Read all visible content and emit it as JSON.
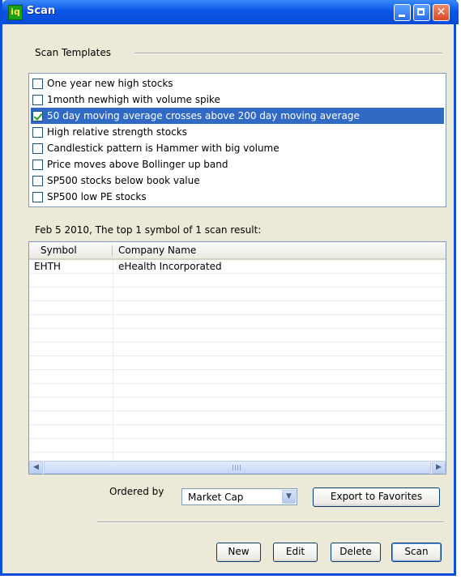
{
  "window": {
    "title": "Scan",
    "app_icon_glyph": "iq"
  },
  "templates": {
    "heading": "Scan Templates",
    "items": [
      {
        "label": "One year new high stocks",
        "checked": false,
        "selected": false
      },
      {
        "label": "1month newhigh with volume spike",
        "checked": false,
        "selected": false
      },
      {
        "label": "50 day moving average crosses above 200 day moving average",
        "checked": true,
        "selected": true
      },
      {
        "label": "High relative strength stocks",
        "checked": false,
        "selected": false
      },
      {
        "label": "Candlestick pattern is Hammer with big volume",
        "checked": false,
        "selected": false
      },
      {
        "label": "Price moves above Bollinger up band",
        "checked": false,
        "selected": false
      },
      {
        "label": "SP500 stocks below book value",
        "checked": false,
        "selected": false
      },
      {
        "label": "SP500 low PE stocks",
        "checked": false,
        "selected": false
      }
    ]
  },
  "results": {
    "summary": "Feb 5 2010, The top 1 symbol of 1 scan result:",
    "columns": {
      "symbol": "Symbol",
      "company": "Company Name"
    },
    "rows": [
      {
        "symbol": "EHTH",
        "company": "eHealth Incorporated"
      },
      {
        "symbol": "",
        "company": ""
      },
      {
        "symbol": "",
        "company": ""
      },
      {
        "symbol": "",
        "company": ""
      },
      {
        "symbol": "",
        "company": ""
      },
      {
        "symbol": "",
        "company": ""
      },
      {
        "symbol": "",
        "company": ""
      },
      {
        "symbol": "",
        "company": ""
      },
      {
        "symbol": "",
        "company": ""
      },
      {
        "symbol": "",
        "company": ""
      },
      {
        "symbol": "",
        "company": ""
      },
      {
        "symbol": "",
        "company": ""
      },
      {
        "symbol": "",
        "company": ""
      },
      {
        "symbol": "",
        "company": ""
      }
    ]
  },
  "order": {
    "label": "Ordered by",
    "selected": "Market Cap"
  },
  "buttons": {
    "export": "Export to Favorites",
    "new": "New",
    "edit": "Edit",
    "delete": "Delete",
    "scan": "Scan"
  },
  "colors": {
    "titlebar": "#0a56e8",
    "selection": "#316ac5",
    "face": "#ece9d8"
  }
}
